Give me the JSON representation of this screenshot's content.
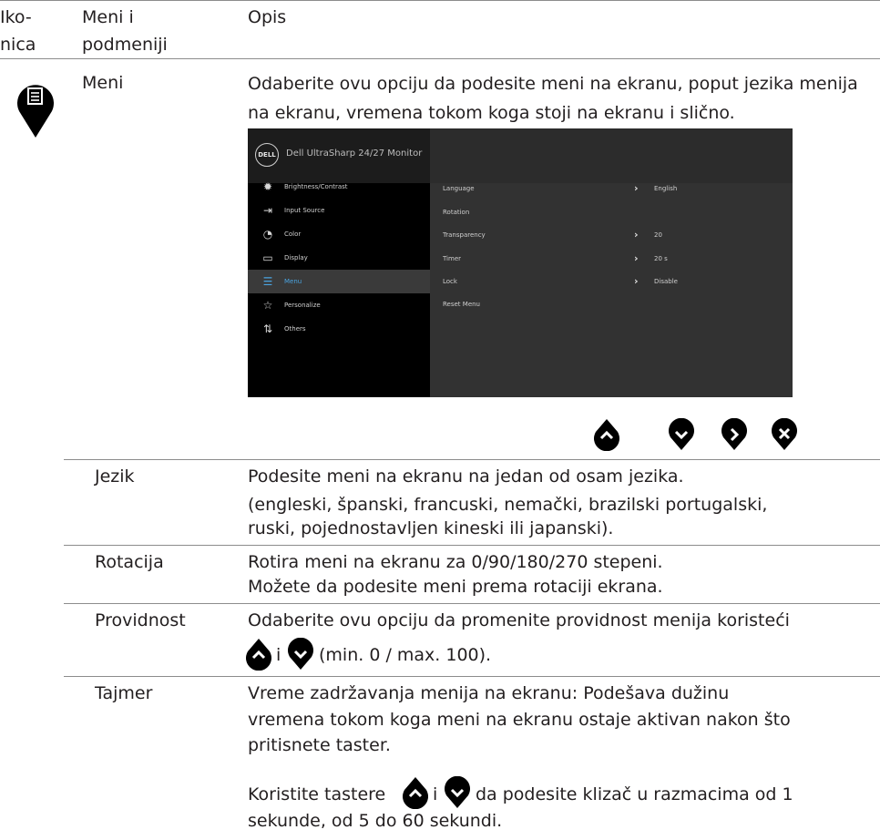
{
  "header": {
    "col1": "Iko-\nnica",
    "col2": "Meni i\npodmeniji",
    "col3": "Opis"
  },
  "menu_section": {
    "icon": "menu-list-icon",
    "name": "Meni",
    "description": "Odaberite ovu opciju da podesite meni na ekranu, poput jezika menija na ekranu, vremena tokom koga stoji na ekranu i slično."
  },
  "osd": {
    "logo": "DELL",
    "title": "Dell UltraSharp 24/27 Monitor",
    "menu_items": [
      {
        "icon": "sun-icon",
        "label": "Brightness/Contrast"
      },
      {
        "icon": "input-icon",
        "label": "Input Source"
      },
      {
        "icon": "palette-icon",
        "label": "Color"
      },
      {
        "icon": "monitor-icon",
        "label": "Display"
      },
      {
        "icon": "menu-icon",
        "label": "Menu"
      },
      {
        "icon": "star-icon",
        "label": "Personalize"
      },
      {
        "icon": "others-icon",
        "label": "Others"
      }
    ],
    "selected_index": 4,
    "settings": [
      {
        "label": "Language",
        "value": "English"
      },
      {
        "label": "Rotation",
        "value": ""
      },
      {
        "label": "Transparency",
        "value": "20"
      },
      {
        "label": "Timer",
        "value": "20 s"
      },
      {
        "label": "Lock",
        "value": "Disable"
      },
      {
        "label": "Reset Menu",
        "value": ""
      }
    ],
    "buttons": [
      "up-icon",
      "down-icon",
      "right-icon",
      "close-icon"
    ]
  },
  "rows": [
    {
      "name": "Jezik",
      "lines": [
        "Podesite meni na ekranu na jedan od osam jezika.",
        "(engleski, španski, francuski, nemački, brazilski portugalski,",
        "ruski, pojednostavljen kineski ili japanski)."
      ]
    },
    {
      "name": "Rotacija",
      "lines": [
        "Rotira meni na ekranu za 0/90/180/270 stepeni.",
        "Možete da podesite meni prema rotaciji ekrana."
      ]
    },
    {
      "name": "Providnost",
      "lines": [
        "Odaberite ovu opciju da promenite providnost menija koristeći",
        "i",
        "(min. 0 / max. 100)."
      ]
    },
    {
      "name": "Tajmer",
      "lines": [
        "Vreme zadržavanja menija na ekranu: Podešava dužinu",
        "vremena tokom koga meni na ekranu ostaje aktivan nakon što",
        "pritisnete taster.",
        "Koristite tastere",
        "i",
        "da podesite klizač u razmacima od 1",
        "sekunde, od 5 do 60 sekundi."
      ]
    }
  ]
}
